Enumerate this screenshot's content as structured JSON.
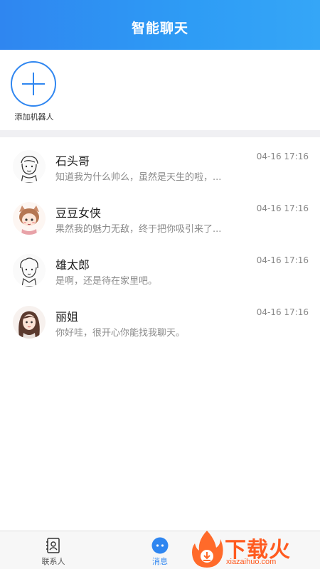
{
  "header": {
    "title": "智能聊天"
  },
  "add_robot": {
    "label": "添加机器人"
  },
  "chats": [
    {
      "name": "石头哥",
      "time": "04-16 17:16",
      "preview": "知道我为什么帅么，虽然是天生的啦，..."
    },
    {
      "name": "豆豆女侠",
      "time": "04-16 17:16",
      "preview": "果然我的魅力无敌，终于把你吸引来了..."
    },
    {
      "name": "雄太郎",
      "time": "04-16 17:16",
      "preview": "是啊，还是待在家里吧。"
    },
    {
      "name": "丽姐",
      "time": "04-16 17:16",
      "preview": "你好哇，很开心你能找我聊天。"
    }
  ],
  "tabs": {
    "contacts": {
      "label": "联系人",
      "icon": "contacts-card-icon"
    },
    "messages": {
      "label": "消息",
      "icon": "message-bubble-icon"
    }
  },
  "watermark": {
    "text": "下载火",
    "sub": "xiazaihuo.com"
  },
  "colors": {
    "accent": "#2f86f0",
    "watermark": "#ff5a1f"
  }
}
